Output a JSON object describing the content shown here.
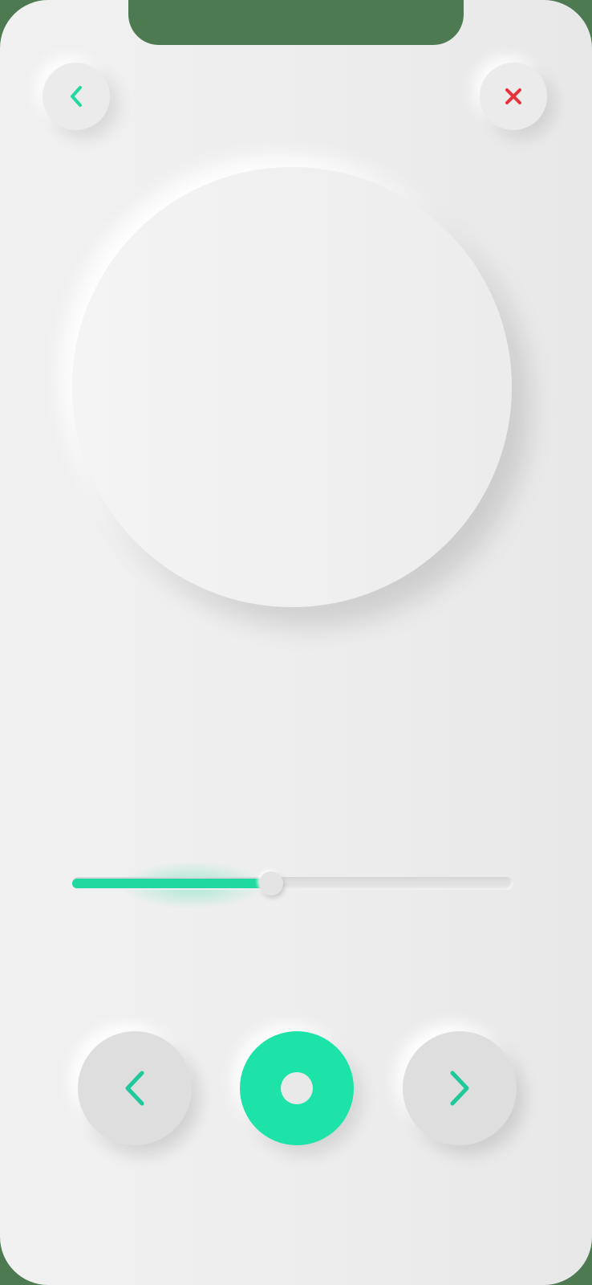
{
  "header": {
    "back_icon": "chevron-left-icon",
    "close_icon": "close-icon"
  },
  "player": {
    "artwork": "album-art-circle",
    "progress": 0.45,
    "controls": {
      "previous_icon": "chevron-left-icon",
      "play_icon": "play-record-icon",
      "next_icon": "chevron-right-icon"
    }
  },
  "colors": {
    "accent": "#1de3a8",
    "close": "#e8323c",
    "background": "#ececec"
  }
}
